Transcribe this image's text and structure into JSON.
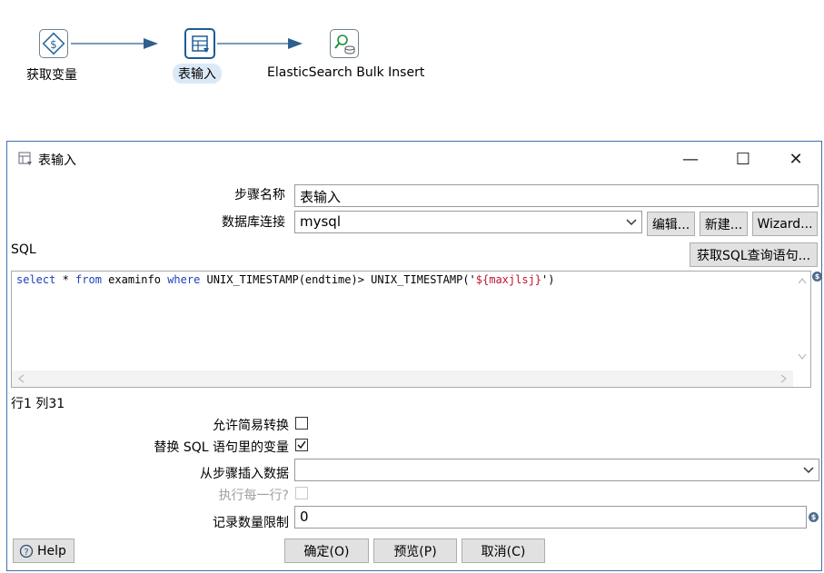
{
  "canvas": {
    "steps": [
      {
        "name": "获取变量",
        "icon": "dollar-diamond-icon"
      },
      {
        "name": "表输入",
        "icon": "table-input-icon",
        "selected": true
      },
      {
        "name": "ElasticSearch Bulk Insert",
        "icon": "elasticsearch-icon"
      }
    ]
  },
  "dialog": {
    "title": "表输入",
    "window_controls": {
      "minimize": "—",
      "maximize": "☐",
      "close": "✕"
    },
    "step_name": {
      "label": "步骤名称",
      "value": "表输入"
    },
    "connection": {
      "label": "数据库连接",
      "value": "mysql",
      "edit": "编辑...",
      "new": "新建...",
      "wizard": "Wizard..."
    },
    "sql_label": "SQL",
    "get_sql_button": "获取SQL查询语句...",
    "sql": {
      "tokens": [
        {
          "t": "select",
          "k": "kw"
        },
        {
          "t": " * ",
          "k": ""
        },
        {
          "t": "from",
          "k": "kw"
        },
        {
          "t": " examinfo ",
          "k": ""
        },
        {
          "t": "where",
          "k": "kw"
        },
        {
          "t": " UNIX_TIMESTAMP(endtime)> UNIX_TIMESTAMP('",
          "k": ""
        },
        {
          "t": "${maxjlsj}",
          "k": "str"
        },
        {
          "t": "')",
          "k": ""
        }
      ]
    },
    "cursor_position": "行1 列31",
    "lazy_conversion": {
      "label": "允许简易转换",
      "checked": false
    },
    "replace_variables": {
      "label": "替换 SQL 语句里的变量",
      "checked": true
    },
    "insert_from_step": {
      "label": "从步骤插入数据",
      "value": ""
    },
    "execute_each_row": {
      "label": "执行每一行?",
      "checked": false
    },
    "limit": {
      "label": "记录数量限制",
      "value": "0"
    },
    "help": "Help",
    "ok": "确定(O)",
    "preview": "预览(P)",
    "cancel": "取消(C)",
    "accent": "#3b73b0"
  }
}
